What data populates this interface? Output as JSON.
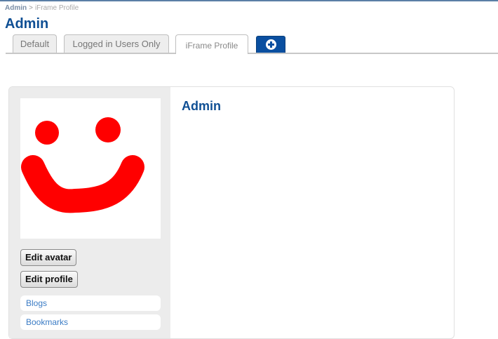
{
  "breadcrumb": {
    "parent": "Admin",
    "separator": ">",
    "current": "iFrame Profile"
  },
  "page": {
    "title": "Admin"
  },
  "tabs": [
    {
      "label": "Default",
      "active": false
    },
    {
      "label": "Logged in Users Only",
      "active": false
    },
    {
      "label": "iFrame Profile",
      "active": true
    }
  ],
  "add_tab": {
    "icon": "plus-circle-icon"
  },
  "sidebar": {
    "avatar": {
      "icon": "smiley-face-drawing",
      "color": "#ff0000"
    },
    "buttons": {
      "edit_avatar": "Edit avatar",
      "edit_profile": "Edit profile"
    },
    "links": [
      {
        "label": "Blogs"
      },
      {
        "label": "Bookmarks"
      }
    ]
  },
  "profile": {
    "name": "Admin"
  },
  "colors": {
    "title": "#0f4f94",
    "link": "#3b7cc5",
    "add_tab": "#0a4fa0",
    "sidebar_bg": "#ececec"
  }
}
